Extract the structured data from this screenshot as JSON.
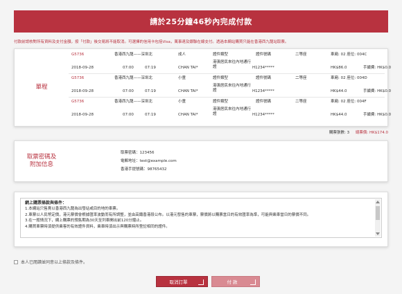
{
  "header": {
    "title": "請於25分鐘46秒內完成付款"
  },
  "notice": "付款前請核對所有資料及支付金額，按「付款」後交易將不能取消。可選擇的信用卡包括Visa，萬事達及銀聯在線支付。透過本網站購買只能在香港西九龍站取票。",
  "trips_label": "單程",
  "trips": [
    {
      "train": "G5736",
      "route": "香港西九龍——深圳北",
      "class": "成人",
      "type_label": "證件類型",
      "id_label": "證件號碼",
      "seat_class": "二等座",
      "seat": "車廂: 02  座位: 004C",
      "date": "2018-09-28",
      "depart": "07:00",
      "arrive": "07:19",
      "name": "CHAN TAI*",
      "doc": "港澳居民來往內地通行證",
      "id": "H1234*****",
      "price": "HK$86.0",
      "fee": "手續費: HK$0.0"
    },
    {
      "train": "G5736",
      "route": "香港西九龍——深圳北",
      "class": "小童",
      "type_label": "證件類型",
      "id_label": "證件號碼",
      "seat_class": "二等座",
      "seat": "車廂: 02  座位: 004D",
      "date": "2018-09-28",
      "depart": "07:00",
      "arrive": "07:19",
      "name": "CHAN TAI*",
      "doc": "港澳居民來往內地通行證",
      "id": "H1234*****",
      "price": "HK$44.0",
      "fee": "手續費: HK$0.0"
    },
    {
      "train": "G5736",
      "route": "香港西九龍——深圳北",
      "class": "小童",
      "type_label": "證件類型",
      "id_label": "證件號碼",
      "seat_class": "二等座",
      "seat": "車廂: 02  座位: 004F",
      "date": "2018-09-28",
      "depart": "07:00",
      "arrive": "07:19",
      "name": "CHAN TAI*",
      "doc": "港澳居民來往內地通行證",
      "id": "H1234*****",
      "price": "HK$44.0",
      "fee": "手續費: HK$0.0"
    }
  ],
  "summary": {
    "count_label": "購票張數: 3",
    "total_label": "總票價: HK$174.0"
  },
  "contact": {
    "label": "取票密碼及附加信息",
    "code": "取票密碼：123456",
    "email": "電郵地址：test@example.com",
    "phone": "香港手提號碼：98765432"
  },
  "terms": {
    "title": "網上購票條款與條件：",
    "lines": [
      "1.本網站只售賣以香港西九龍為出發站或目的地的車票。",
      "2.車票以人民幣定價，港元票價會根據匯率波動而有所調整，並由高鐵香港段公布。以港元發售的車票，票價將以購票當日的有效匯率為準，可能與乘車當日的票價不同。",
      "3.在一般情況下，網上購票的預售期為30天至列車開出前120分鐘止。",
      "4.購買車票時須提供乘客的有效證件資料，乘車時須出示與購票時所登記相同的證件。"
    ]
  },
  "agree_label": "本人已閱讀並同意以上條款及條件。",
  "buttons": {
    "cancel": "取消訂單",
    "pay": "付  款"
  },
  "colors": {
    "accent": "#b8323f"
  }
}
